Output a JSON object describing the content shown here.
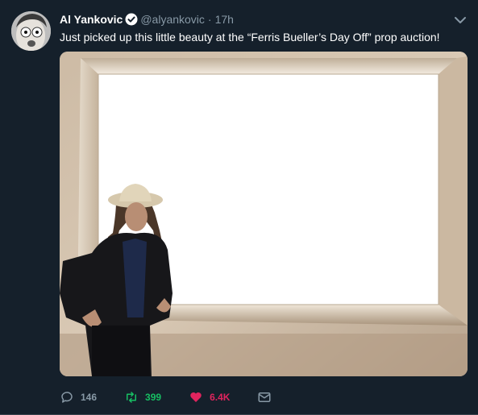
{
  "tweet": {
    "display_name": "Al Yankovic",
    "handle": "@alyankovic",
    "separator": "·",
    "time": "17h",
    "text": "Just picked up this little beauty at the “Ferris Bueller’s Day Off” prop auction!",
    "media_alt": "Man in a hat and black puffer jacket leaning next to a large empty white picture frame"
  },
  "actions": {
    "replies": "146",
    "retweets": "399",
    "likes": "6.4K"
  },
  "colors": {
    "background": "#15202b",
    "text_secondary": "#8899a6",
    "retweet": "#17bf63",
    "like": "#e0245e",
    "verified": "#1da1f2"
  },
  "icons": [
    "avatar",
    "verified-icon",
    "chevron-down-icon",
    "reply-icon",
    "retweet-icon",
    "heart-icon",
    "envelope-icon"
  ]
}
